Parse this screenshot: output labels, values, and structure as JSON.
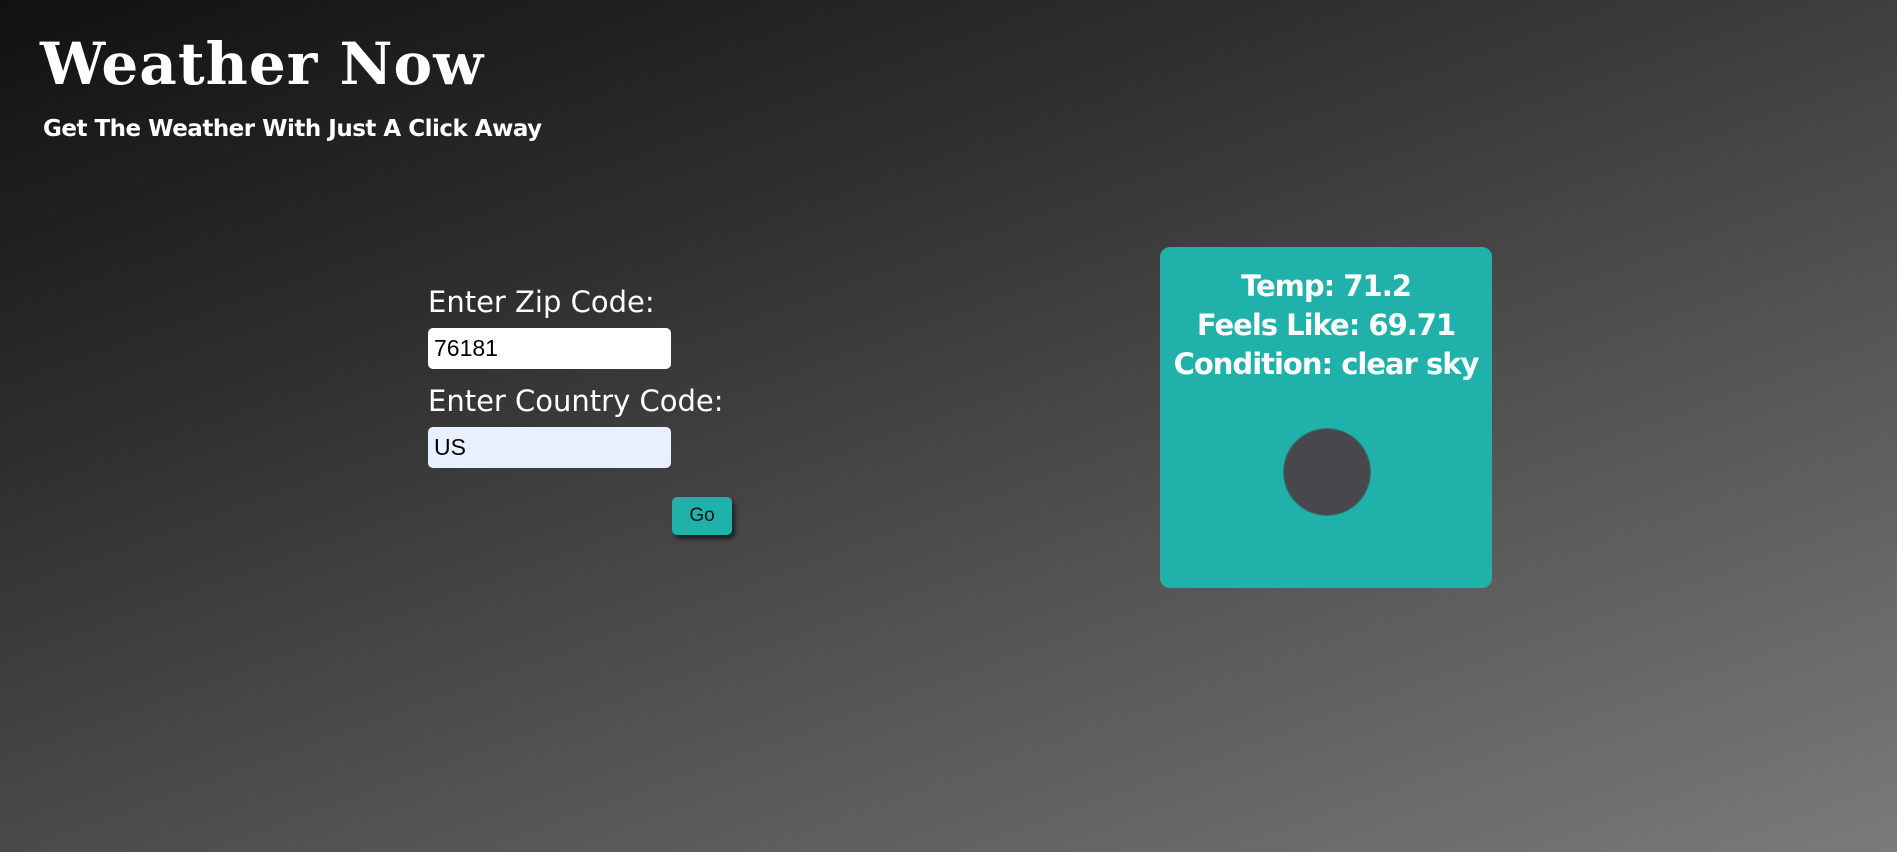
{
  "header": {
    "title": "Weather Now",
    "subtitle": "Get The Weather With Just A Click Away"
  },
  "form": {
    "zip_label": "Enter Zip Code:",
    "zip_value": "76181",
    "country_label": "Enter Country Code:",
    "country_value": "US",
    "go_label": "Go"
  },
  "weather": {
    "temp": "Temp: 71.2",
    "feels_like": "Feels Like: 69.71",
    "condition": "Condition: clear sky",
    "icon": "weather-condition-icon"
  },
  "colors": {
    "accent": "#20b2aa",
    "icon_placeholder": "#48484c",
    "autofill_bg": "#e8f0fe"
  }
}
